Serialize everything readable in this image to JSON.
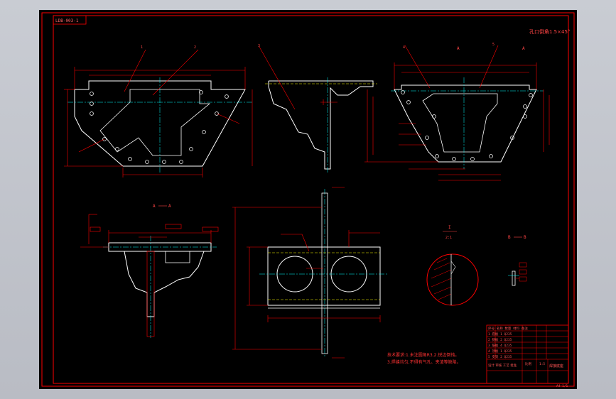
{
  "colors": {
    "background": "#000000",
    "border": "#ff0000",
    "outline": "#ffffff",
    "dimension": "#ff0000",
    "center": "#00ffff",
    "hidden": "#ffff00",
    "note": "#ff3333",
    "title_block": "#ff0000"
  },
  "drawing": {
    "drawing_number": "LDB-003-1",
    "corner_note": "孔口倒角1.5×45°",
    "sheet_label": "A4·1/1"
  },
  "section_labels": {
    "view_a_left": "A",
    "view_a_right": "A",
    "section_aa_left": "A",
    "section_aa_right": "A",
    "section_bb_left": "B",
    "section_bb_right": "B",
    "detail_i": "I",
    "detail_scale": "2:1"
  },
  "balloons": [
    "1",
    "2",
    "3",
    "4",
    "5"
  ],
  "tech_notes": {
    "line1": "技术要求:1.未注圆角R3,2.锐边倒钝。",
    "line2": "3.焊缝均匀,不得有气孔、夹渣等缺陷。"
  },
  "title_block": {
    "rows": [
      "序号 名称 数量 材料 备注",
      "1 底板 1 Q235",
      "2 侧板 2 Q235",
      "3 筋板 4 Q235",
      "4 顶板 1 Q235",
      "5 支架 2 Q235"
    ],
    "title": "焊接底座",
    "company": "设计 审核 工艺 批准",
    "scale": "1:5",
    "weight": "比例"
  }
}
